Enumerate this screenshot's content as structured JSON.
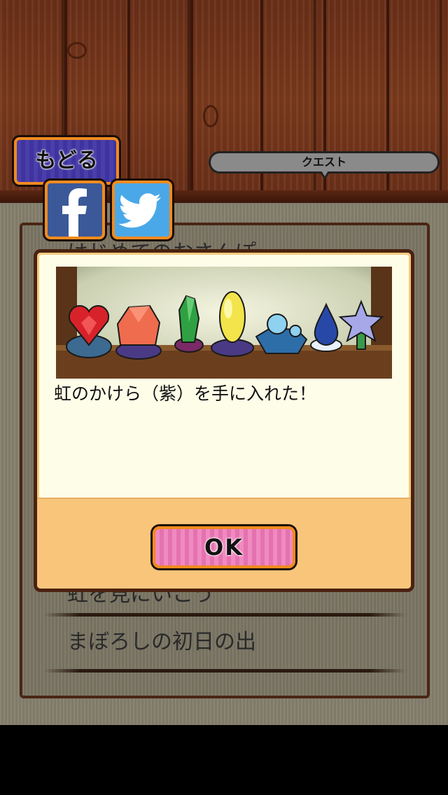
{
  "header": {
    "back_label": "もどる",
    "quest_tab_label": "クエスト"
  },
  "social": {
    "facebook_icon": "facebook-icon",
    "twitter_icon": "twitter-icon"
  },
  "quest_list": {
    "items": [
      {
        "label": "はじめてのおさんぽ"
      },
      {
        "label": "虹を見にいこう"
      },
      {
        "label": "まぼろしの初日の出"
      }
    ]
  },
  "dialog": {
    "message": "虹のかけら（紫）を手に入れた！",
    "ok_label": "OK",
    "image": "rainbow-gem-pieces-illustration"
  },
  "colors": {
    "button_border": "#f08b20",
    "back_button": "#4a3ea8",
    "ok_button": "#f08ac0",
    "dialog_footer": "#f8c57a"
  }
}
